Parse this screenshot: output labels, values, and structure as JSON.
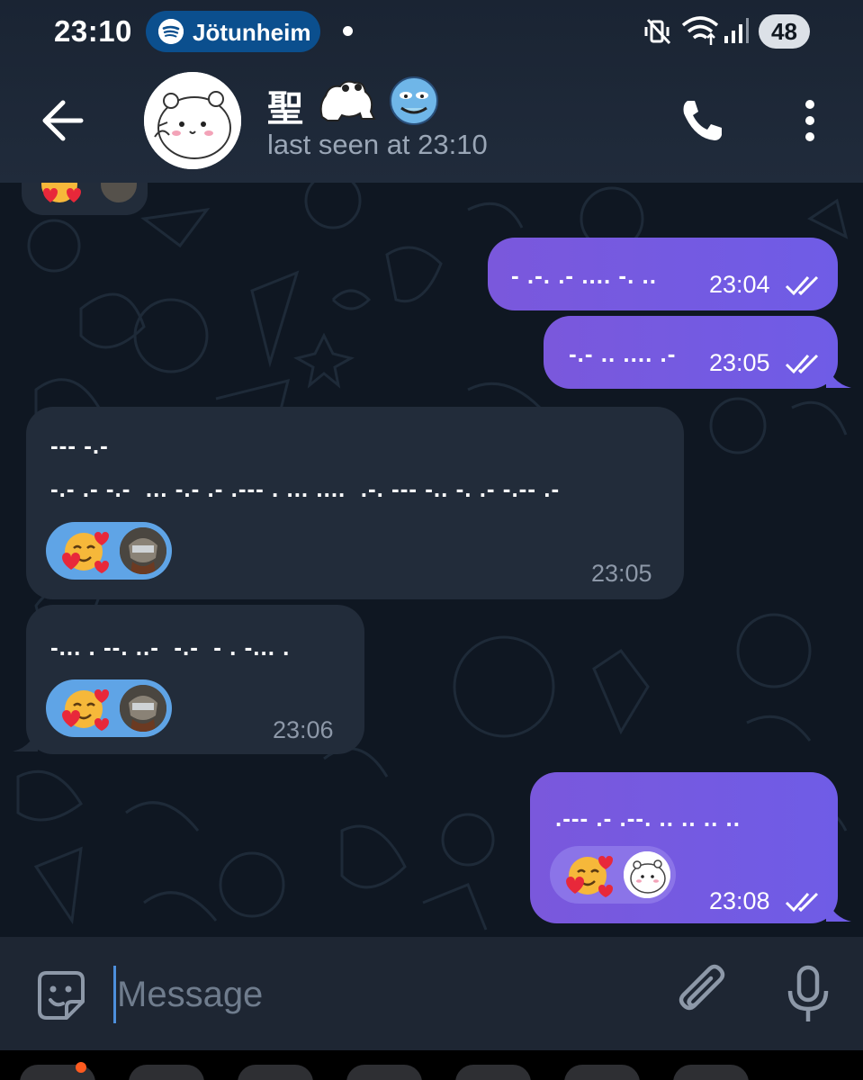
{
  "status_bar": {
    "time": "23:10",
    "spotify_label": "Jötunheim",
    "battery": "48"
  },
  "header": {
    "contact_name": "聖",
    "last_seen": "last seen at 23:10"
  },
  "messages": [
    {
      "direction": "outgoing",
      "text": "- .-. .- .... -. ..",
      "time": "23:04",
      "read": true
    },
    {
      "direction": "outgoing",
      "text": "-.- .. .... .-",
      "time": "23:05",
      "read": true
    },
    {
      "direction": "incoming",
      "lines": [
        "--- -.-",
        "-.- .- -.-  ... -.- .- .--- . ... ....  .-. --- -.. -. .- -.-- .-"
      ],
      "time": "23:05",
      "reaction": "smiling-face-with-hearts"
    },
    {
      "direction": "incoming",
      "lines": [
        "-... . --. ..-  -.-  - . -... ."
      ],
      "time": "23:06",
      "reaction": "smiling-face-with-hearts"
    },
    {
      "direction": "outgoing",
      "text": ".--- .- .--. .. .. .. ..",
      "time": "23:08",
      "read": true,
      "reaction": "smiling-face-with-hearts"
    }
  ],
  "input": {
    "placeholder": "Message"
  },
  "colors": {
    "outgoing_bubble": "#7a58dc",
    "incoming_bubble": "#222c3a",
    "background": "#0f1722",
    "reaction_incoming": "#5fa4e6",
    "reaction_outgoing": "#8b74e8"
  }
}
